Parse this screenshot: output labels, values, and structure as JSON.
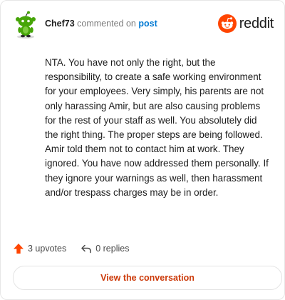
{
  "header": {
    "username": "Chef73",
    "action_text": "commented on",
    "post_link": "post",
    "brand_name": "reddit"
  },
  "comment": {
    "body": "NTA. You have not only the right, but the responsibility, to create a safe working environment for your employees. Very simply, his parents are not only harassing Amir, but are also causing problems for the rest of your staff as well. You absolutely did the right thing. The proper steps are being followed. Amir told them not to contact him at work. They ignored. You have now addressed them personally. If they ignore your warnings as well, then harassment and/or trespass charges may be in order."
  },
  "actions": {
    "upvotes_label": "3 upvotes",
    "replies_label": "0 replies"
  },
  "footer": {
    "view_label": "View the conversation"
  },
  "colors": {
    "brand_orange": "#ff4500",
    "link_blue": "#0079d3",
    "avatar_green": "#46a508",
    "button_text": "#cc3a0a"
  },
  "icons": {
    "avatar": "snoo-avatar-icon",
    "brand": "reddit-logo-icon",
    "upvote": "upvote-arrow-icon",
    "reply": "reply-arrow-icon"
  }
}
